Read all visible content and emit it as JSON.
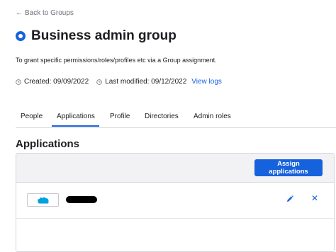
{
  "nav": {
    "back_label": "Back to Groups"
  },
  "group": {
    "title": "Business admin group",
    "description": "To grant specific permissions/roles/profiles etc via a Group assignment.",
    "created": "Created: 09/09/2022",
    "modified": "Last modified: 09/12/2022",
    "view_logs": "View logs"
  },
  "tabs": [
    {
      "label": "People"
    },
    {
      "label": "Applications",
      "active": true
    },
    {
      "label": "Profile"
    },
    {
      "label": "Directories"
    },
    {
      "label": "Admin roles"
    }
  ],
  "section": {
    "title": "Applications",
    "assign_label": "Assign applications"
  },
  "apps": [
    {
      "logo": "salesforce-logo",
      "name_redacted": true
    }
  ],
  "colors": {
    "accent": "#1662dd",
    "text": "#1d1d21",
    "muted": "#6e6e78",
    "salesforce": "#00a1e0"
  }
}
